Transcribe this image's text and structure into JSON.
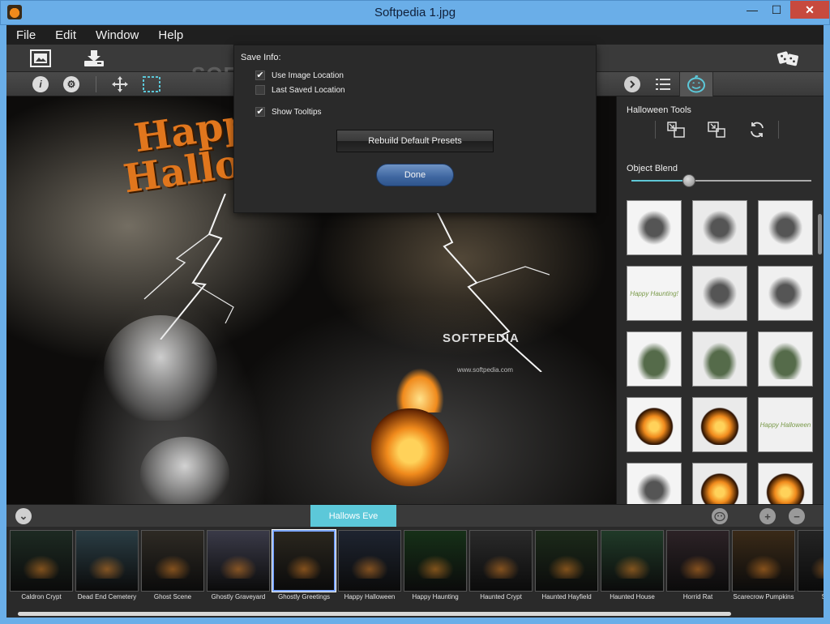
{
  "window": {
    "title": "Softpedia 1.jpg",
    "minimize_glyph": "—",
    "maximize_glyph": "☐",
    "close_glyph": "✕"
  },
  "menu": {
    "items": [
      "File",
      "Edit",
      "Window",
      "Help"
    ]
  },
  "toolbar": {
    "watermark": "SOFTPEDIA",
    "info_glyph": "i",
    "settings_glyph": "⚙"
  },
  "popup": {
    "title": "Save Info:",
    "options": [
      {
        "label": "Use Image Location",
        "checked": true
      },
      {
        "label": "Last Saved Location",
        "checked": false
      },
      {
        "label": "Show Tooltips",
        "checked": true
      }
    ],
    "check_glyph": "✔",
    "rebuild_label": "Rebuild Default Presets",
    "done_label": "Done"
  },
  "canvas": {
    "happy_text": "Happy",
    "halloween_text": "Halloween",
    "softpedia_text": "SOFTPEDIA",
    "url_text": "www.softpedia.com"
  },
  "right_panel": {
    "tools_title": "Halloween Tools",
    "blend_label": "Object Blend",
    "blend_value": 0.32,
    "thumbnails": [
      {
        "text": ""
      },
      {
        "text": ""
      },
      {
        "text": ""
      },
      {
        "text": "Happy Haunting!"
      },
      {
        "text": ""
      },
      {
        "text": ""
      },
      {
        "text": ""
      },
      {
        "text": ""
      },
      {
        "text": ""
      },
      {
        "text": ""
      },
      {
        "text": ""
      },
      {
        "text": "Happy Halloween"
      },
      {
        "text": ""
      },
      {
        "text": ""
      },
      {
        "text": ""
      }
    ]
  },
  "bottombar": {
    "active_preset": "Hallows Eve",
    "collapse_glyph": "⌄",
    "add_glyph": "+",
    "remove_glyph": "−"
  },
  "filmstrip": {
    "selected_index": 4,
    "items": [
      {
        "label": "Caldron Crypt"
      },
      {
        "label": "Dead End Cemetery"
      },
      {
        "label": "Ghost Scene"
      },
      {
        "label": "Ghostly Graveyard"
      },
      {
        "label": "Ghostly Greetings"
      },
      {
        "label": "Happy Halloween"
      },
      {
        "label": "Happy Haunting"
      },
      {
        "label": "Haunted Crypt"
      },
      {
        "label": "Haunted Hayfield"
      },
      {
        "label": "Haunted House"
      },
      {
        "label": "Horrid Rat"
      },
      {
        "label": "Scarecrow Pumpkins"
      },
      {
        "label": "Spoo"
      }
    ]
  },
  "colors": {
    "accent": "#5cc8d9",
    "done_button": "#3e66a0",
    "title_bar": "#6aaee8"
  }
}
